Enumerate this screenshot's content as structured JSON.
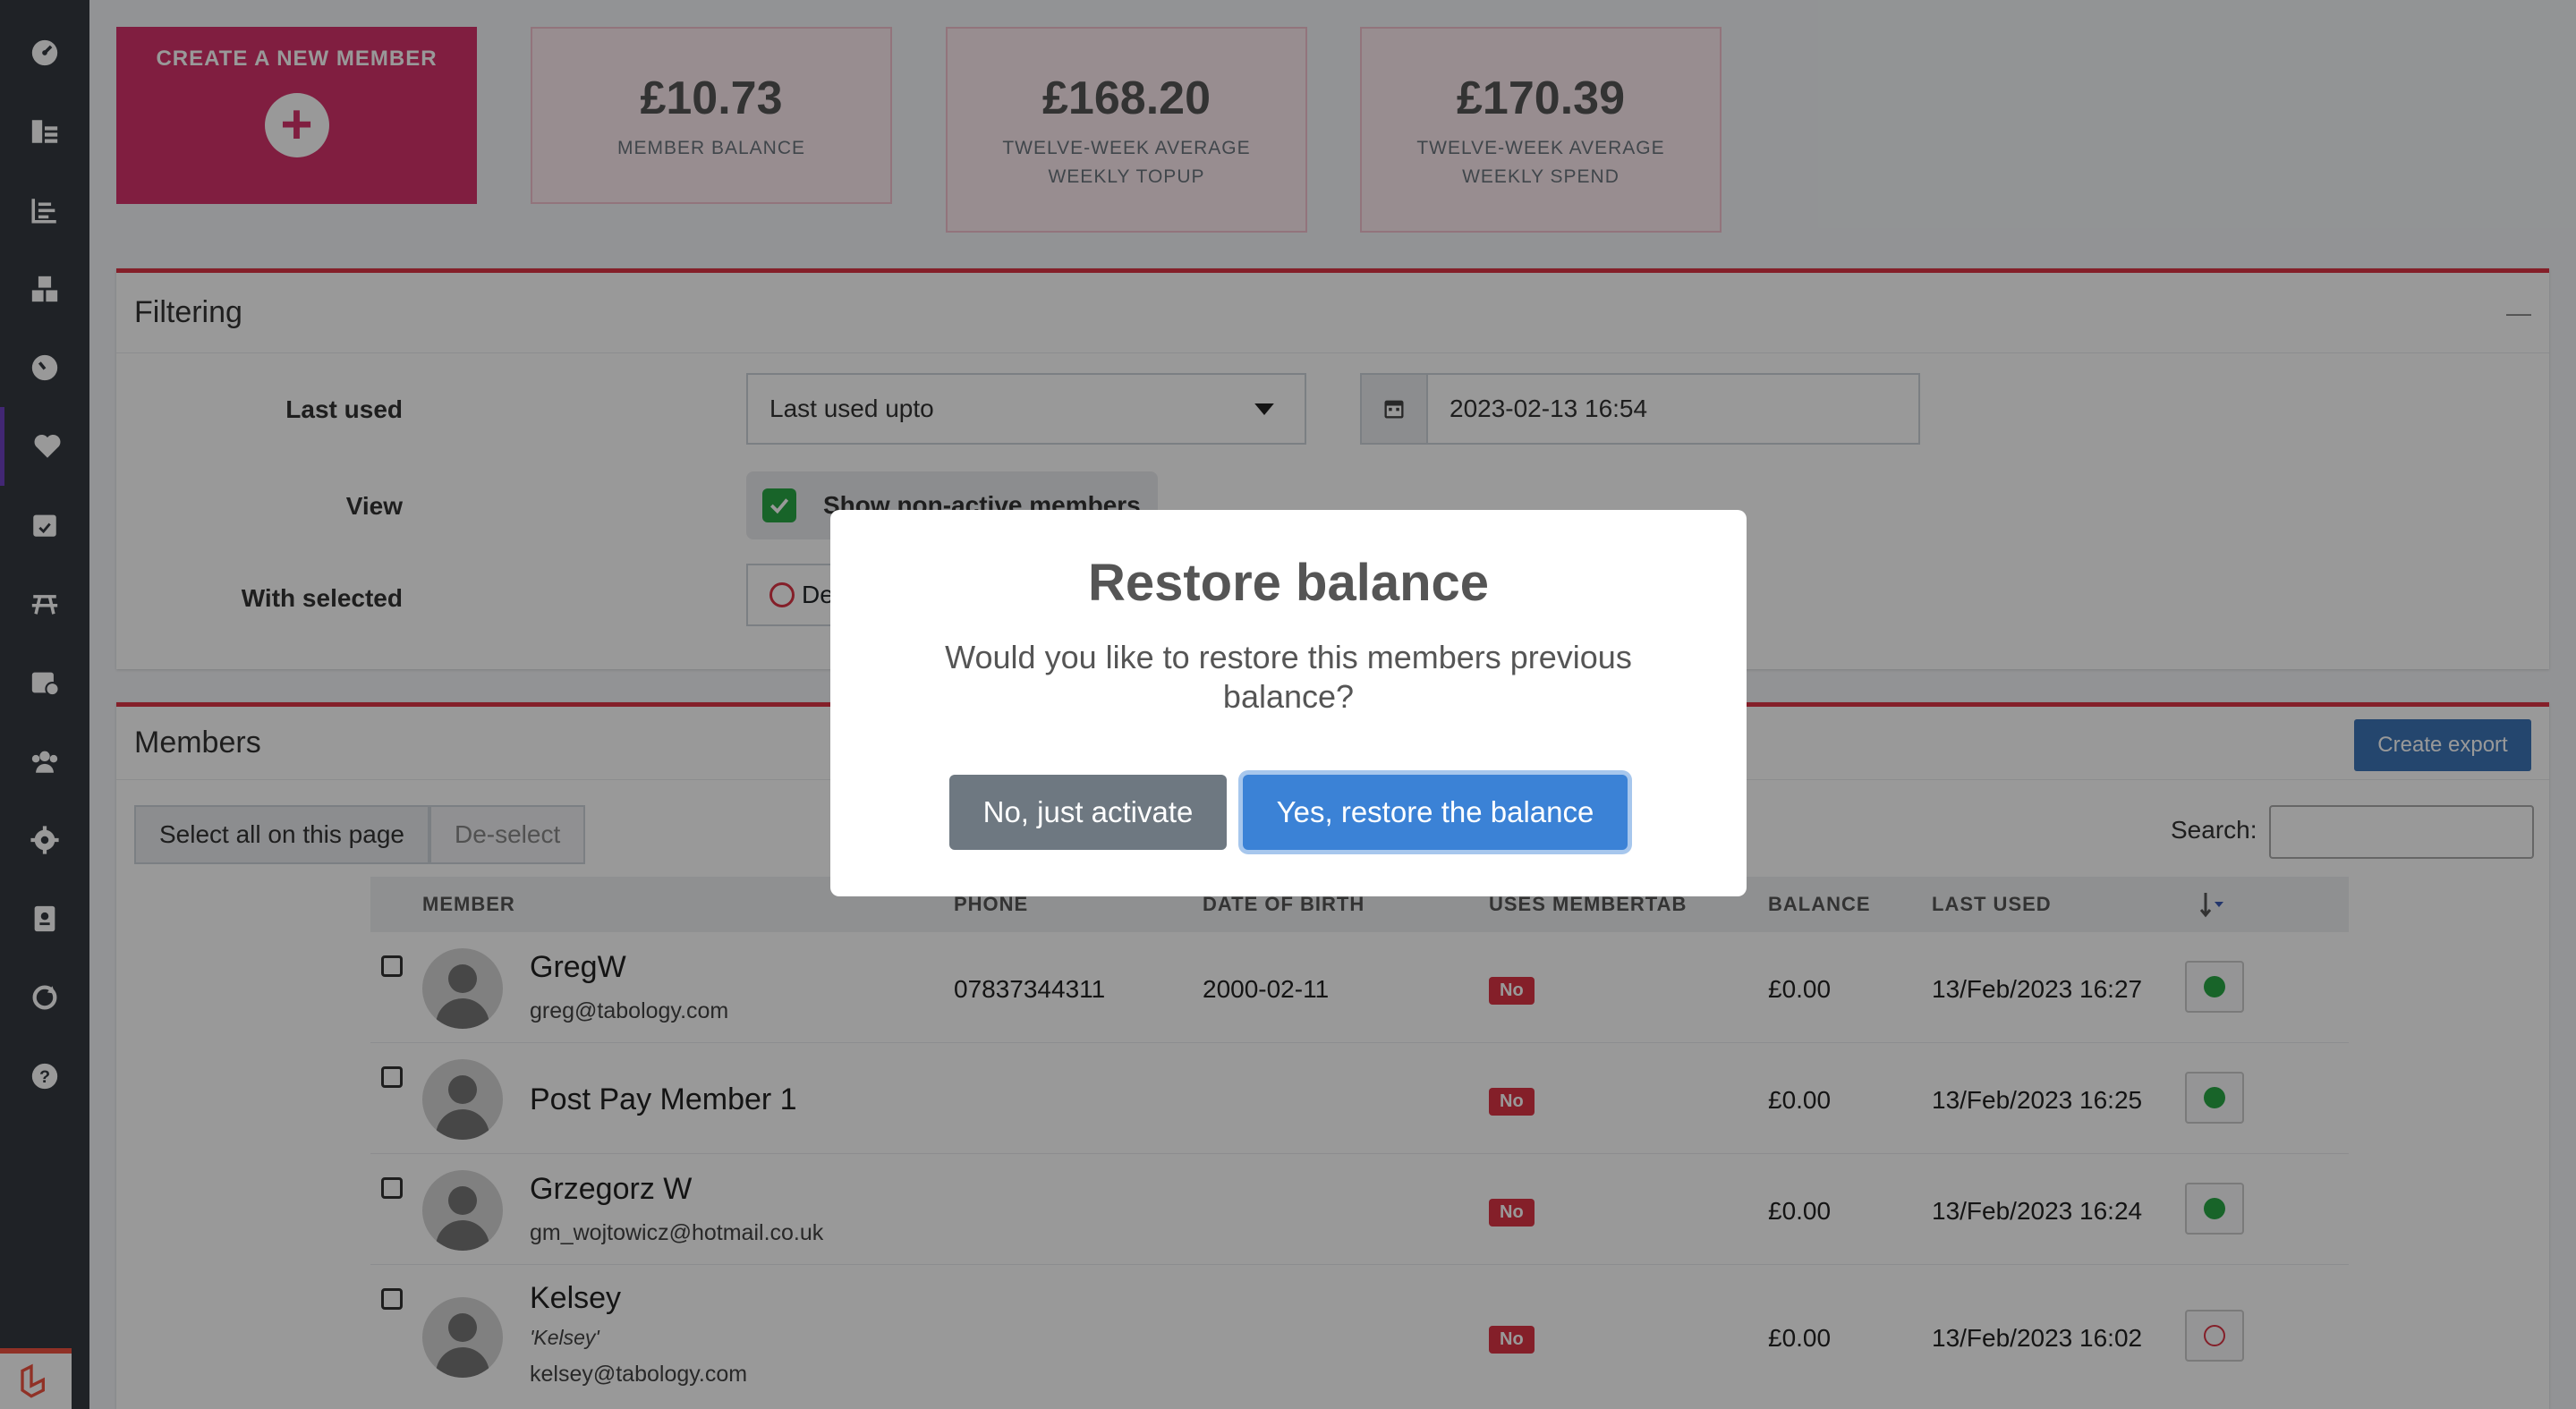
{
  "sidebar": {
    "items": [
      {
        "icon": "dashboard-icon"
      },
      {
        "icon": "tables-icon"
      },
      {
        "icon": "reports-icon"
      },
      {
        "icon": "products-icon"
      },
      {
        "icon": "speedometer-icon"
      },
      {
        "icon": "heart-icon",
        "active": true
      },
      {
        "icon": "calendar-check-icon"
      },
      {
        "icon": "picnic-table-icon"
      },
      {
        "icon": "calendar-clock-icon"
      },
      {
        "icon": "users-icon"
      },
      {
        "icon": "gear-icon"
      },
      {
        "icon": "file-user-icon"
      },
      {
        "icon": "sync-icon"
      },
      {
        "icon": "help-icon"
      }
    ]
  },
  "stats": {
    "create_label": "CREATE A NEW MEMBER",
    "boxes": [
      {
        "value": "£10.73",
        "caption_line1": "MEMBER BALANCE",
        "caption_line2": ""
      },
      {
        "value": "£168.20",
        "caption_line1": "TWELVE-WEEK AVERAGE",
        "caption_line2": "WEEKLY TOPUP"
      },
      {
        "value": "£170.39",
        "caption_line1": "TWELVE-WEEK AVERAGE",
        "caption_line2": "WEEKLY SPEND"
      }
    ]
  },
  "filtering": {
    "title": "Filtering",
    "collapse_symbol": "—",
    "last_used_label": "Last used",
    "last_used_select": "Last used upto",
    "date_value": "2023-02-13 16:54",
    "view_label": "View",
    "show_inactive_label": "Show non-active members",
    "with_selected_label": "With selected",
    "with_selected_option": "De"
  },
  "members": {
    "title": "Members",
    "export_label": "Create export",
    "select_all_label": "Select all on this page",
    "deselect_label": "De-select",
    "search_label": "Search:",
    "search_value": "",
    "columns": [
      "MEMBER",
      "PHONE",
      "DATE OF BIRTH",
      "USES MEMBERTAB",
      "BALANCE",
      "LAST USED"
    ],
    "rows": [
      {
        "name": "GregW",
        "alias": "",
        "email": "greg@tabology.com",
        "phone": "07837344311",
        "dob": "2000-02-11",
        "uses_membertab": "No",
        "balance": "£0.00",
        "last_used": "13/Feb/2023 16:27",
        "active": true
      },
      {
        "name": "Post Pay Member 1",
        "alias": "",
        "email": "",
        "phone": "",
        "dob": "",
        "uses_membertab": "No",
        "balance": "£0.00",
        "last_used": "13/Feb/2023 16:25",
        "active": true
      },
      {
        "name": "Grzegorz W",
        "alias": "",
        "email": "gm_wojtowicz@hotmail.co.uk",
        "phone": "",
        "dob": "",
        "uses_membertab": "No",
        "balance": "£0.00",
        "last_used": "13/Feb/2023 16:24",
        "active": true
      },
      {
        "name": "Kelsey",
        "alias": "'Kelsey'",
        "email": "kelsey@tabology.com",
        "phone": "",
        "dob": "",
        "uses_membertab": "No",
        "balance": "£0.00",
        "last_used": "13/Feb/2023 16:02",
        "active": false
      }
    ]
  },
  "modal": {
    "title": "Restore balance",
    "body": "Would you like to restore this members previous balance?",
    "no_label": "No, just activate",
    "yes_label": "Yes, restore the balance"
  },
  "colors": {
    "accent": "#d6336c",
    "card_border": "#dc3545",
    "primary": "#3b82d6",
    "secondary": "#6e7881",
    "success": "#28a745"
  }
}
